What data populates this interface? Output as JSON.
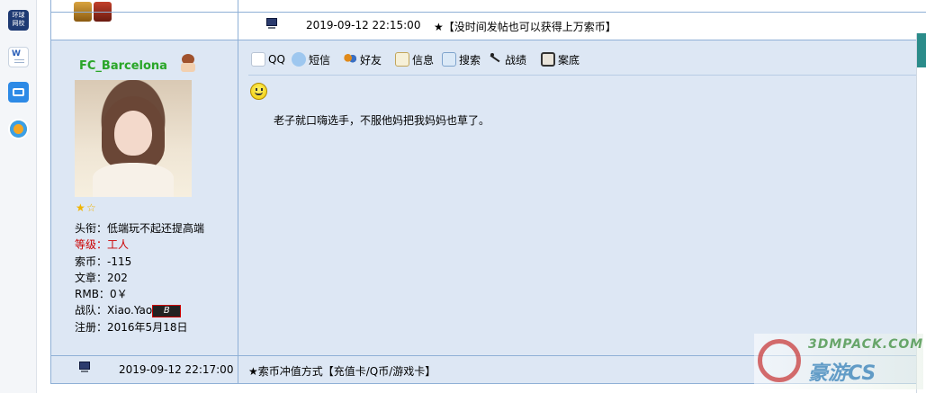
{
  "launcher": {
    "app1_label": "环球\n网校"
  },
  "top_row": {
    "timestamp": "2019-09-12 22:15:00",
    "signature": "★【没时间发帖也可以获得上万索币】"
  },
  "post": {
    "username": "FC_Barcelona",
    "star_count": 2,
    "info": {
      "title_label": "头衔：",
      "title_value": "低端玩不起还提高端",
      "level_label": "等级：",
      "level_value": "工人",
      "coins_label": "索币：",
      "coins_value": "-115",
      "articles_label": "文章：",
      "articles_value": "202",
      "rmb_label": "RMB：",
      "rmb_value": "0￥",
      "team_label": "战队：",
      "team_value": "Xiao.Yao",
      "team_badge": "B",
      "reg_label": "注册：",
      "reg_value": "2016年5月18日"
    },
    "toolbar": {
      "qq": "QQ",
      "sms": "短信",
      "friend": "好友",
      "info": "信息",
      "search": "搜索",
      "record": "战绩",
      "case": "案底"
    },
    "content": "老子就口嗨选手，不服他妈把我妈妈也草了。"
  },
  "footer": {
    "timestamp": "2019-09-12 22:17:00",
    "signature": "★索币冲值方式【充值卡/Q币/游戏卡】"
  },
  "watermark": {
    "line1": "3DMPACK.COM",
    "line2": "豪游CS"
  },
  "colors": {
    "border": "#8fb0d6",
    "cell_bg": "#dde7f4",
    "username": "#2aa52a",
    "level": "#cc0000"
  }
}
